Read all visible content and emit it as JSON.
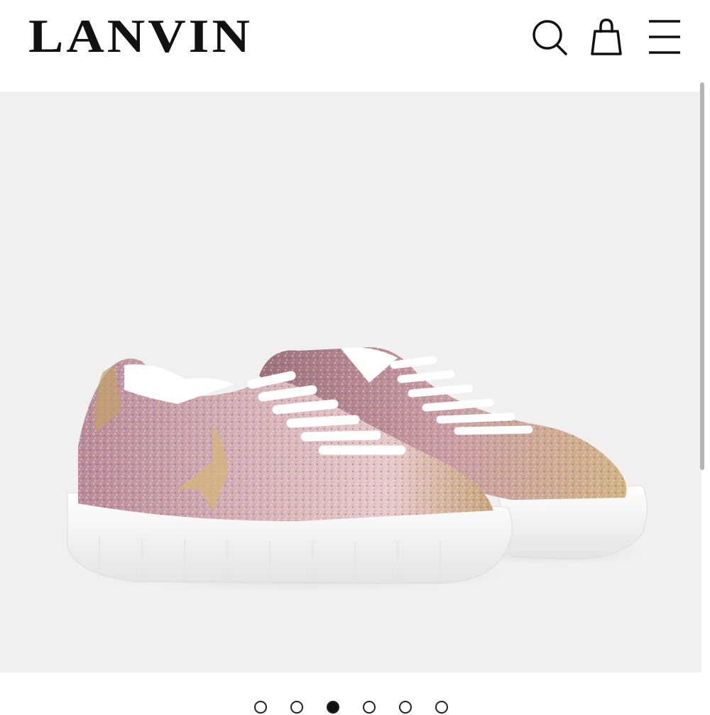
{
  "header": {
    "logo": "LANVIN",
    "search_icon": "search-icon",
    "bag_icon": "shopping-bag-icon",
    "menu_icon": "hamburger-menu-icon"
  },
  "product_gallery": {
    "image": "glitter-sneakers-image",
    "total_slides": 6,
    "active_slide": 3
  },
  "colors": {
    "background": "#ffffff",
    "gallery_background": "#f0f0f0",
    "text": "#111111"
  }
}
